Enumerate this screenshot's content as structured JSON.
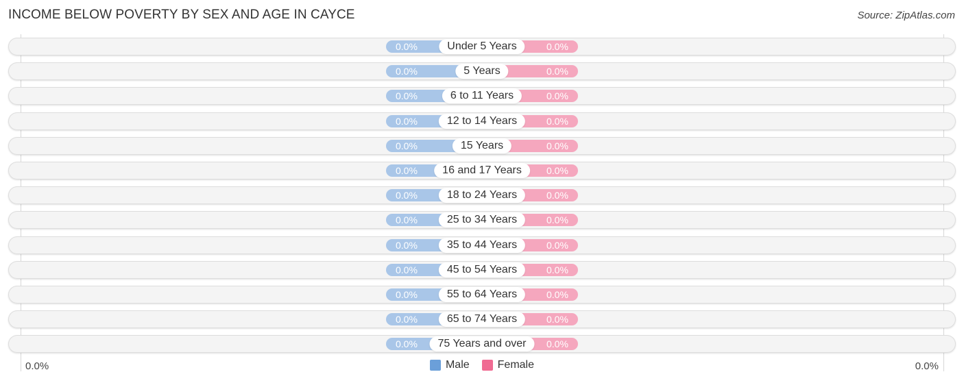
{
  "title": "INCOME BELOW POVERTY BY SEX AND AGE IN CAYCE",
  "source": "Source: ZipAtlas.com",
  "chart_data": {
    "type": "bar",
    "orientation": "horizontal-diverging",
    "title": "INCOME BELOW POVERTY BY SEX AND AGE IN CAYCE",
    "categories": [
      "Under 5 Years",
      "5 Years",
      "6 to 11 Years",
      "12 to 14 Years",
      "15 Years",
      "16 and 17 Years",
      "18 to 24 Years",
      "25 to 34 Years",
      "35 to 44 Years",
      "45 to 54 Years",
      "55 to 64 Years",
      "65 to 74 Years",
      "75 Years and over"
    ],
    "series": [
      {
        "name": "Male",
        "color": "#a9c6e8",
        "legend_color": "#6b9fd9",
        "values": [
          0,
          0,
          0,
          0,
          0,
          0,
          0,
          0,
          0,
          0,
          0,
          0,
          0
        ],
        "labels": [
          "0.0%",
          "0.0%",
          "0.0%",
          "0.0%",
          "0.0%",
          "0.0%",
          "0.0%",
          "0.0%",
          "0.0%",
          "0.0%",
          "0.0%",
          "0.0%",
          "0.0%"
        ]
      },
      {
        "name": "Female",
        "color": "#f5a7be",
        "legend_color": "#f06b93",
        "values": [
          0,
          0,
          0,
          0,
          0,
          0,
          0,
          0,
          0,
          0,
          0,
          0,
          0
        ],
        "labels": [
          "0.0%",
          "0.0%",
          "0.0%",
          "0.0%",
          "0.0%",
          "0.0%",
          "0.0%",
          "0.0%",
          "0.0%",
          "0.0%",
          "0.0%",
          "0.0%",
          "0.0%"
        ]
      }
    ],
    "axis": {
      "left_label": "0.0%",
      "right_label": "0.0%",
      "unit": "%"
    },
    "legend": {
      "position": "bottom-center",
      "items": [
        "Male",
        "Female"
      ]
    },
    "grid": false
  }
}
